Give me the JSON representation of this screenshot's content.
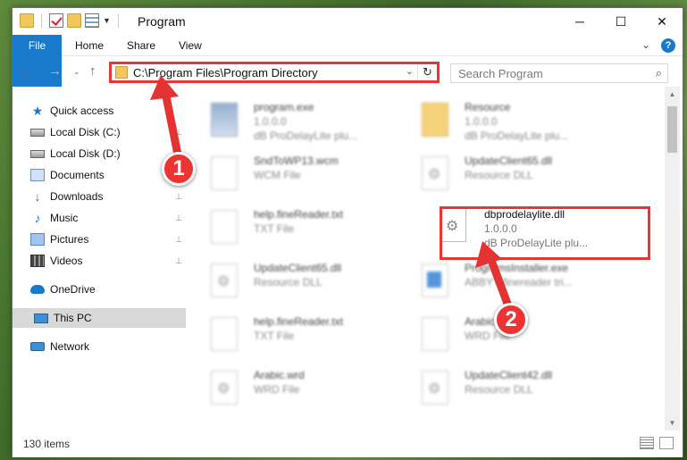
{
  "window": {
    "title": "Program",
    "minimize": "─",
    "maximize": "☐",
    "close": "✕"
  },
  "ribbon": {
    "tabs": [
      "File",
      "Home",
      "Share",
      "View"
    ],
    "expand": "⌄",
    "help": "?"
  },
  "nav": {
    "back": "←",
    "forward": "→",
    "recent": "⌄",
    "up": "↑",
    "address": "C:\\Program Files\\Program Directory",
    "address_dropdown": "⌄",
    "refresh": "↻",
    "search_placeholder": "Search Program",
    "search_icon": "⌕"
  },
  "sidebar": {
    "items": [
      {
        "label": "Quick access",
        "icon": "star-icon",
        "pinned": false
      },
      {
        "label": "Local Disk (C:)",
        "icon": "disk-icon",
        "pinned": true
      },
      {
        "label": "Local Disk (D:)",
        "icon": "disk-icon",
        "pinned": false
      },
      {
        "label": "Documents",
        "icon": "documents-icon",
        "pinned": true
      },
      {
        "label": "Downloads",
        "icon": "downloads-icon",
        "pinned": true
      },
      {
        "label": "Music",
        "icon": "music-icon",
        "pinned": true
      },
      {
        "label": "Pictures",
        "icon": "pictures-icon",
        "pinned": true
      },
      {
        "label": "Videos",
        "icon": "videos-icon",
        "pinned": true
      },
      {
        "label": "OneDrive",
        "icon": "onedrive-icon",
        "pinned": false
      },
      {
        "label": "This PC",
        "icon": "this-pc-icon",
        "pinned": false,
        "selected": true
      },
      {
        "label": "Network",
        "icon": "network-icon",
        "pinned": false
      }
    ],
    "pin_glyph": "📌"
  },
  "files": [
    {
      "name": "program.exe",
      "line2": "1.0.0.0",
      "line3": "dB ProDelayLite plu...",
      "icon": "exe-icon"
    },
    {
      "name": "Resource",
      "line2": "1.0.0.0",
      "line3": "dB ProDelayLite plu...",
      "icon": "folder-icon"
    },
    {
      "name": "SndToWP13.wcm",
      "line2": "WCM File",
      "line3": "",
      "icon": "document-icon"
    },
    {
      "name": "UpdateClient65.dll",
      "line2": "Resource DLL",
      "line3": "",
      "icon": "dll-icon"
    },
    {
      "name": "help.fineReader.txt",
      "line2": "TXT File",
      "line3": "",
      "icon": "document-icon"
    },
    {
      "name": "dbprodelaylite.dll",
      "line2": "1.0.0.0",
      "line3": "dB ProDelayLite plu...",
      "icon": "dll-icon",
      "highlighted": true
    },
    {
      "name": "UpdateClient65.dll",
      "line2": "Resource DLL",
      "line3": "",
      "icon": "dll-icon"
    },
    {
      "name": "ProgramsInstaller.exe",
      "line2": "ABBYY finereader tri...",
      "line3": "",
      "icon": "installer-icon"
    },
    {
      "name": "help.fineReader.txt",
      "line2": "TXT File",
      "line3": "",
      "icon": "document-icon"
    },
    {
      "name": "Arabic.wrd",
      "line2": "WRD File",
      "line3": "",
      "icon": "document-icon"
    },
    {
      "name": "Arabic.wrd",
      "line2": "WRD File",
      "line3": "",
      "icon": "document-icon"
    },
    {
      "name": "UpdateClient42.dll",
      "line2": "Resource DLL",
      "line3": "",
      "icon": "dll-icon"
    }
  ],
  "status": {
    "item_count": "130 items"
  },
  "annotations": {
    "callout_1": "1",
    "callout_2": "2",
    "accent_color": "#e33333"
  }
}
